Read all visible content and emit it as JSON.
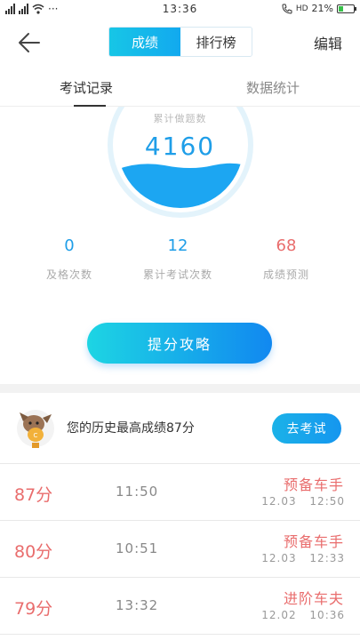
{
  "status_bar": {
    "time": "13:36",
    "battery": "21%",
    "network": "HD",
    "dots": "···"
  },
  "header": {
    "tabs": [
      {
        "label": "成绩",
        "active": true
      },
      {
        "label": "排行榜",
        "active": false
      }
    ],
    "edit_label": "编辑"
  },
  "subtabs": {
    "left": "考试记录",
    "right": "数据统计"
  },
  "gauge": {
    "label": "累计做题数",
    "value": "4160"
  },
  "stats": [
    {
      "value": "0",
      "label": "及格次数"
    },
    {
      "value": "12",
      "label": "累计考试次数"
    },
    {
      "value": "68",
      "label": "成绩预测"
    }
  ],
  "tips_button": "提分攻略",
  "best": {
    "text": "您的历史最高成绩87分",
    "button": "去考试"
  },
  "records": [
    {
      "score": "87分",
      "duration": "11:50",
      "rank": "预备车手",
      "date": "12.03 12:50"
    },
    {
      "score": "80分",
      "duration": "10:51",
      "rank": "预备车手",
      "date": "12.03 12:33"
    },
    {
      "score": "79分",
      "duration": "13:32",
      "rank": "进阶车夫",
      "date": "12.02 10:36"
    }
  ],
  "colors": {
    "accent_blue": "#1f9ee8",
    "score_red": "#e96d6d",
    "gradient_start": "#1dd5e3",
    "gradient_end": "#1188f0"
  }
}
